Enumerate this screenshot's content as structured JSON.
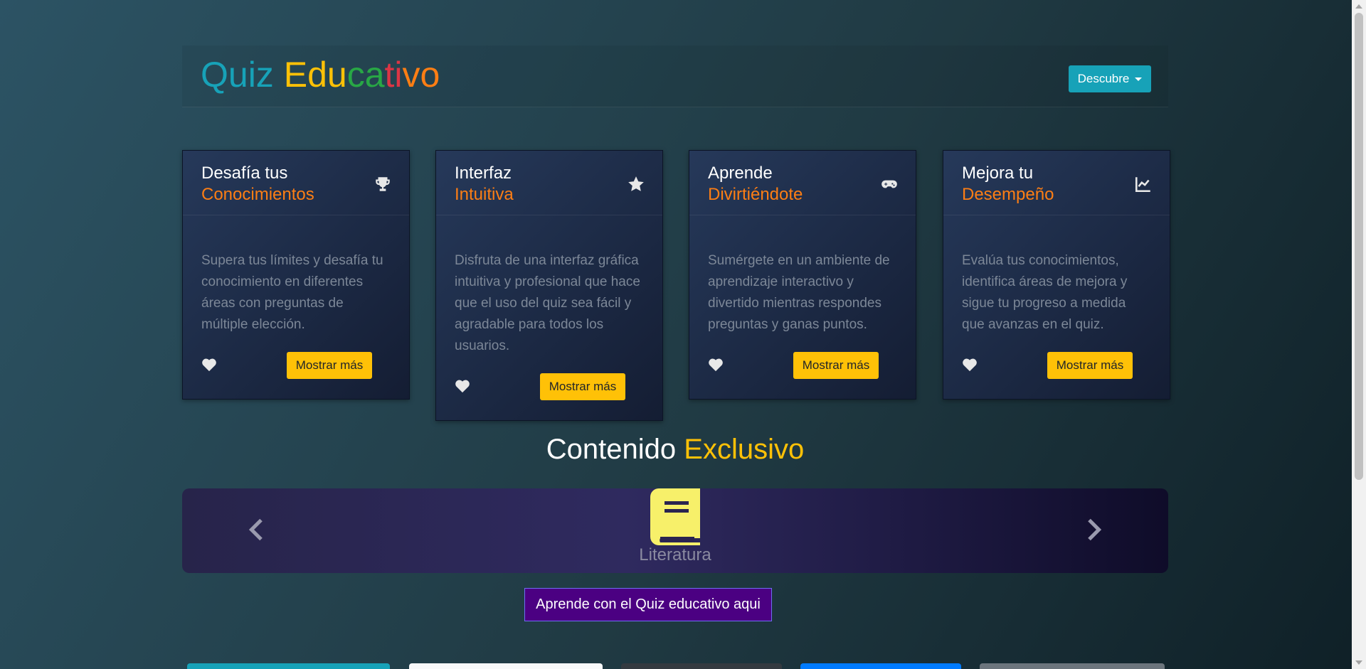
{
  "header": {
    "logo_quiz": "Quiz",
    "logo_letters": [
      "E",
      "d",
      "u",
      "c",
      "a",
      "t",
      "i",
      "v",
      "o"
    ],
    "descubre_label": "Descubre"
  },
  "cards": [
    {
      "title_line1": "Desafía tus",
      "title_line2": "Conocimientos",
      "icon": "trophy-icon",
      "text": "Supera tus límites y desafía tu conocimiento en diferentes áreas con preguntas de múltiple elección.",
      "button": "Mostrar más"
    },
    {
      "title_line1": "Interfaz",
      "title_line2": "Intuitiva",
      "icon": "star-icon",
      "text": "Disfruta de una interfaz gráfica intuitiva y profesional que hace que el uso del quiz sea fácil y agradable para todos los usuarios.",
      "button": "Mostrar más"
    },
    {
      "title_line1": "Aprende",
      "title_line2": "Divirtiéndote",
      "icon": "gamepad-icon",
      "text": "Sumérgete en un ambiente de aprendizaje interactivo y divertido mientras respondes preguntas y ganas puntos.",
      "button": "Mostrar más"
    },
    {
      "title_line1": "Mejora tu",
      "title_line2": "Desempeño",
      "icon": "chart-line-icon",
      "text": "Evalúa tus conocimientos, identifica áreas de mejora y sigue tu progreso a medida que avanzas en el quiz.",
      "button": "Mostrar más"
    }
  ],
  "section": {
    "title_part1": "Contenido",
    "title_part2": "Exclusivo"
  },
  "carousel": {
    "label": "Literatura",
    "icon": "book-icon"
  },
  "cta": {
    "label": "Aprende con el Quiz educativo aqui"
  },
  "colors": {
    "accent_teal": "#17a2b8",
    "accent_yellow": "#ffc107",
    "accent_orange": "#fd7e14",
    "accent_green": "#28a745",
    "accent_red": "#dc3545",
    "cta_purple": "#4b0082"
  }
}
